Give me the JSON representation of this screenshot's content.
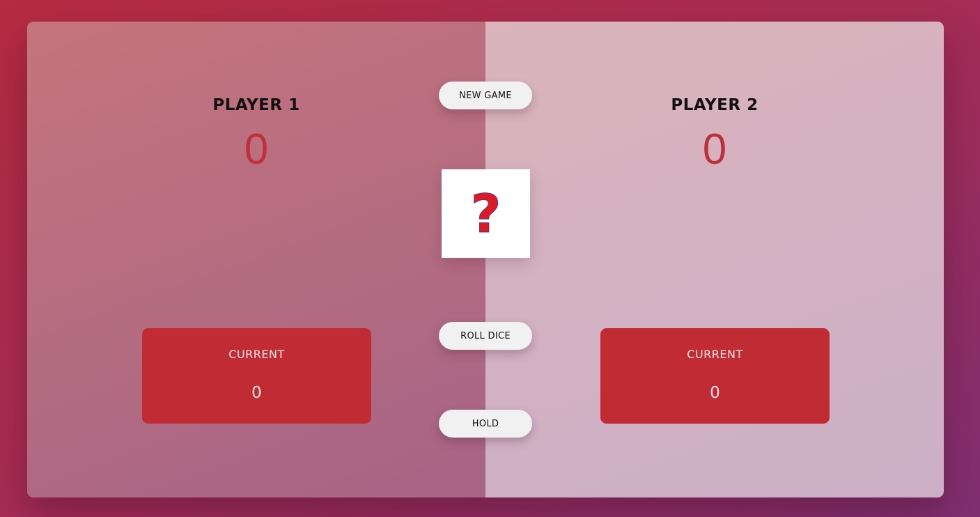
{
  "players": [
    {
      "name": "PLAYER 1",
      "score": "0",
      "current_label": "CURRENT",
      "current_score": "0"
    },
    {
      "name": "PLAYER 2",
      "score": "0",
      "current_label": "CURRENT",
      "current_score": "0"
    }
  ],
  "controls": {
    "new_game_label": "NEW GAME",
    "roll_dice_label": "ROLL DICE",
    "hold_label": "HOLD"
  },
  "dice": {
    "glyph": "?",
    "icon": "question-mark-icon"
  },
  "colors": {
    "accent": "#c12c34",
    "score": "#c0303a",
    "button_bg": "#f1f1f1"
  }
}
